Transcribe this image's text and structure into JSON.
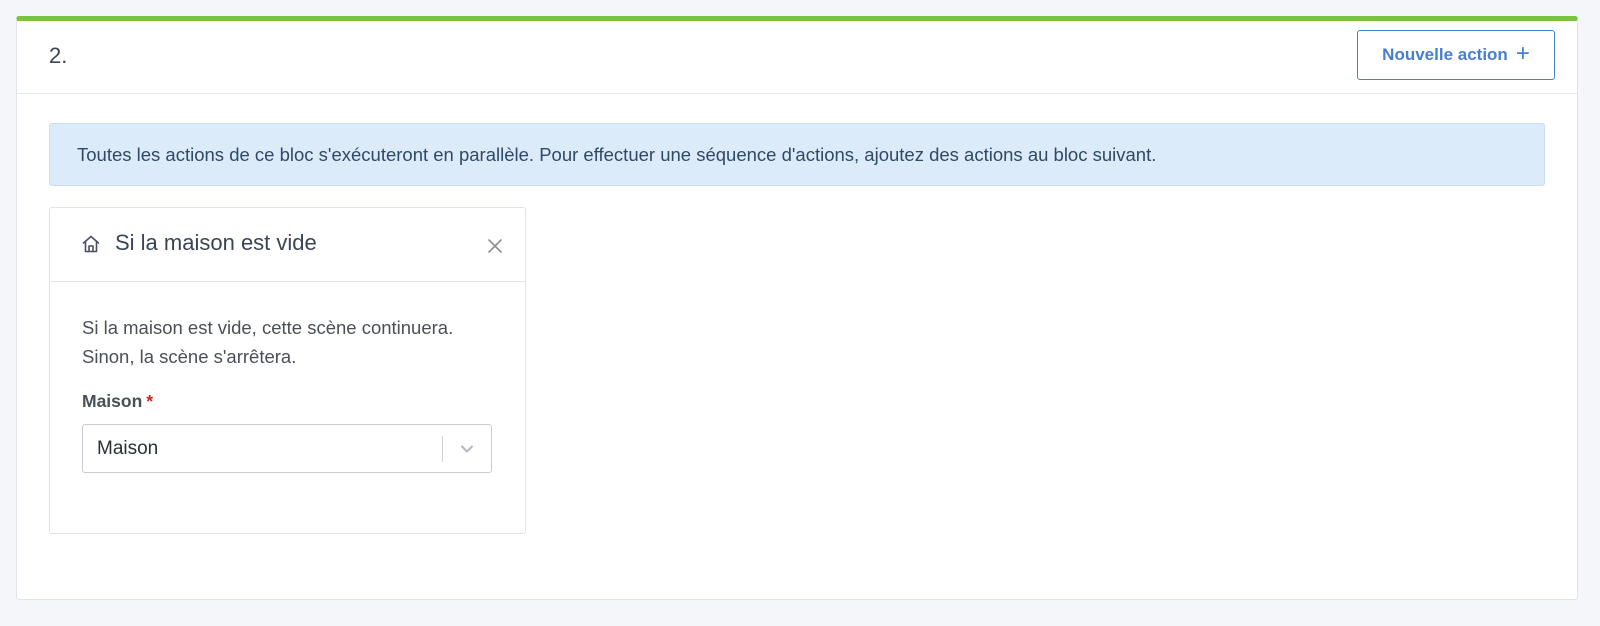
{
  "block": {
    "index": "2.",
    "new_action_label": "Nouvelle action",
    "new_action_icon": "plus-icon",
    "accent_color": "#7bc142"
  },
  "info": {
    "text": "Toutes les actions de ce bloc s'exécuteront en parallèle. Pour effectuer une séquence d'actions, ajoutez des actions au bloc suivant."
  },
  "action": {
    "icon": "home-icon",
    "title": "Si la maison est vide",
    "description": "Si la maison est vide, cette scène continuera. Sinon, la scène s'arrêtera.",
    "field": {
      "label": "Maison",
      "required_mark": "*",
      "selected_value": "Maison"
    }
  }
}
